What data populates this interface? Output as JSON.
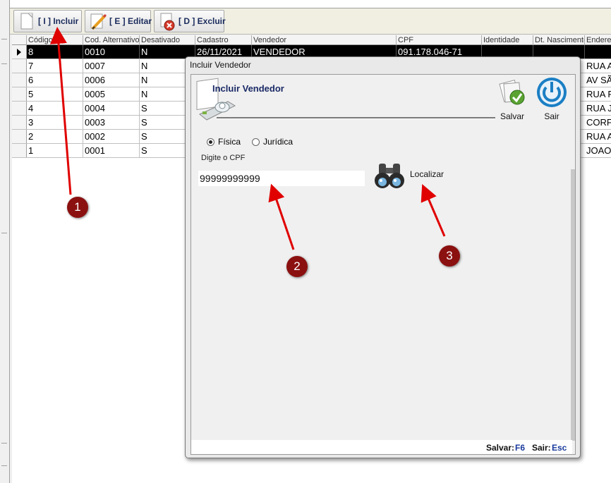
{
  "toolbar": {
    "incluir": "[ I ] Incluir",
    "editar": "[ E ] Editar",
    "excluir": "[ D ] Excluir"
  },
  "grid": {
    "columns": [
      "Código",
      "Cod. Alternativo",
      "Desativado",
      "Cadastro",
      "Vendedor",
      "CPF",
      "Identidade",
      "Dt. Nascimento",
      "Endereço"
    ],
    "rows": [
      {
        "codigo": "8",
        "alt": "0010",
        "desativado": "N",
        "cadastro": "26/11/2021",
        "vendedor": "VENDEDOR",
        "cpf": "091.178.046-71",
        "identidade": "",
        "nascimento": "",
        "endereco": ""
      },
      {
        "codigo": "7",
        "alt": "0007",
        "desativado": "N",
        "endereco": "RUA A"
      },
      {
        "codigo": "6",
        "alt": "0006",
        "desativado": "N",
        "endereco": "AV SÃ"
      },
      {
        "codigo": "5",
        "alt": "0005",
        "desativado": "N",
        "endereco": "RUA F"
      },
      {
        "codigo": "4",
        "alt": "0004",
        "desativado": "S",
        "endereco": "RUA J"
      },
      {
        "codigo": "3",
        "alt": "0003",
        "desativado": "S",
        "endereco": "CORF"
      },
      {
        "codigo": "2",
        "alt": "0002",
        "desativado": "S",
        "endereco": "RUA A"
      },
      {
        "codigo": "1",
        "alt": "0001",
        "desativado": "S",
        "endereco": "JOAO"
      }
    ]
  },
  "dialog": {
    "title": "Incluir Vendedor",
    "header": "Incluir Vendedor",
    "salvar": "Salvar",
    "sair": "Sair",
    "fisica": "Física",
    "juridica": "Jurídica",
    "cpf_label": "Digite o CPF",
    "cpf_value": "99999999999",
    "localizar": "Localizar",
    "status_salvar": "Salvar:",
    "status_salvar_key": "F6",
    "status_sair": "Sair:",
    "status_sair_key": "Esc"
  },
  "annotations": {
    "m1": "1",
    "m2": "2",
    "m3": "3"
  },
  "colors": {
    "marker": "#8b1010",
    "arrow": "#e00000",
    "header_text": "#1a2a66",
    "selected_row": "#000000"
  }
}
